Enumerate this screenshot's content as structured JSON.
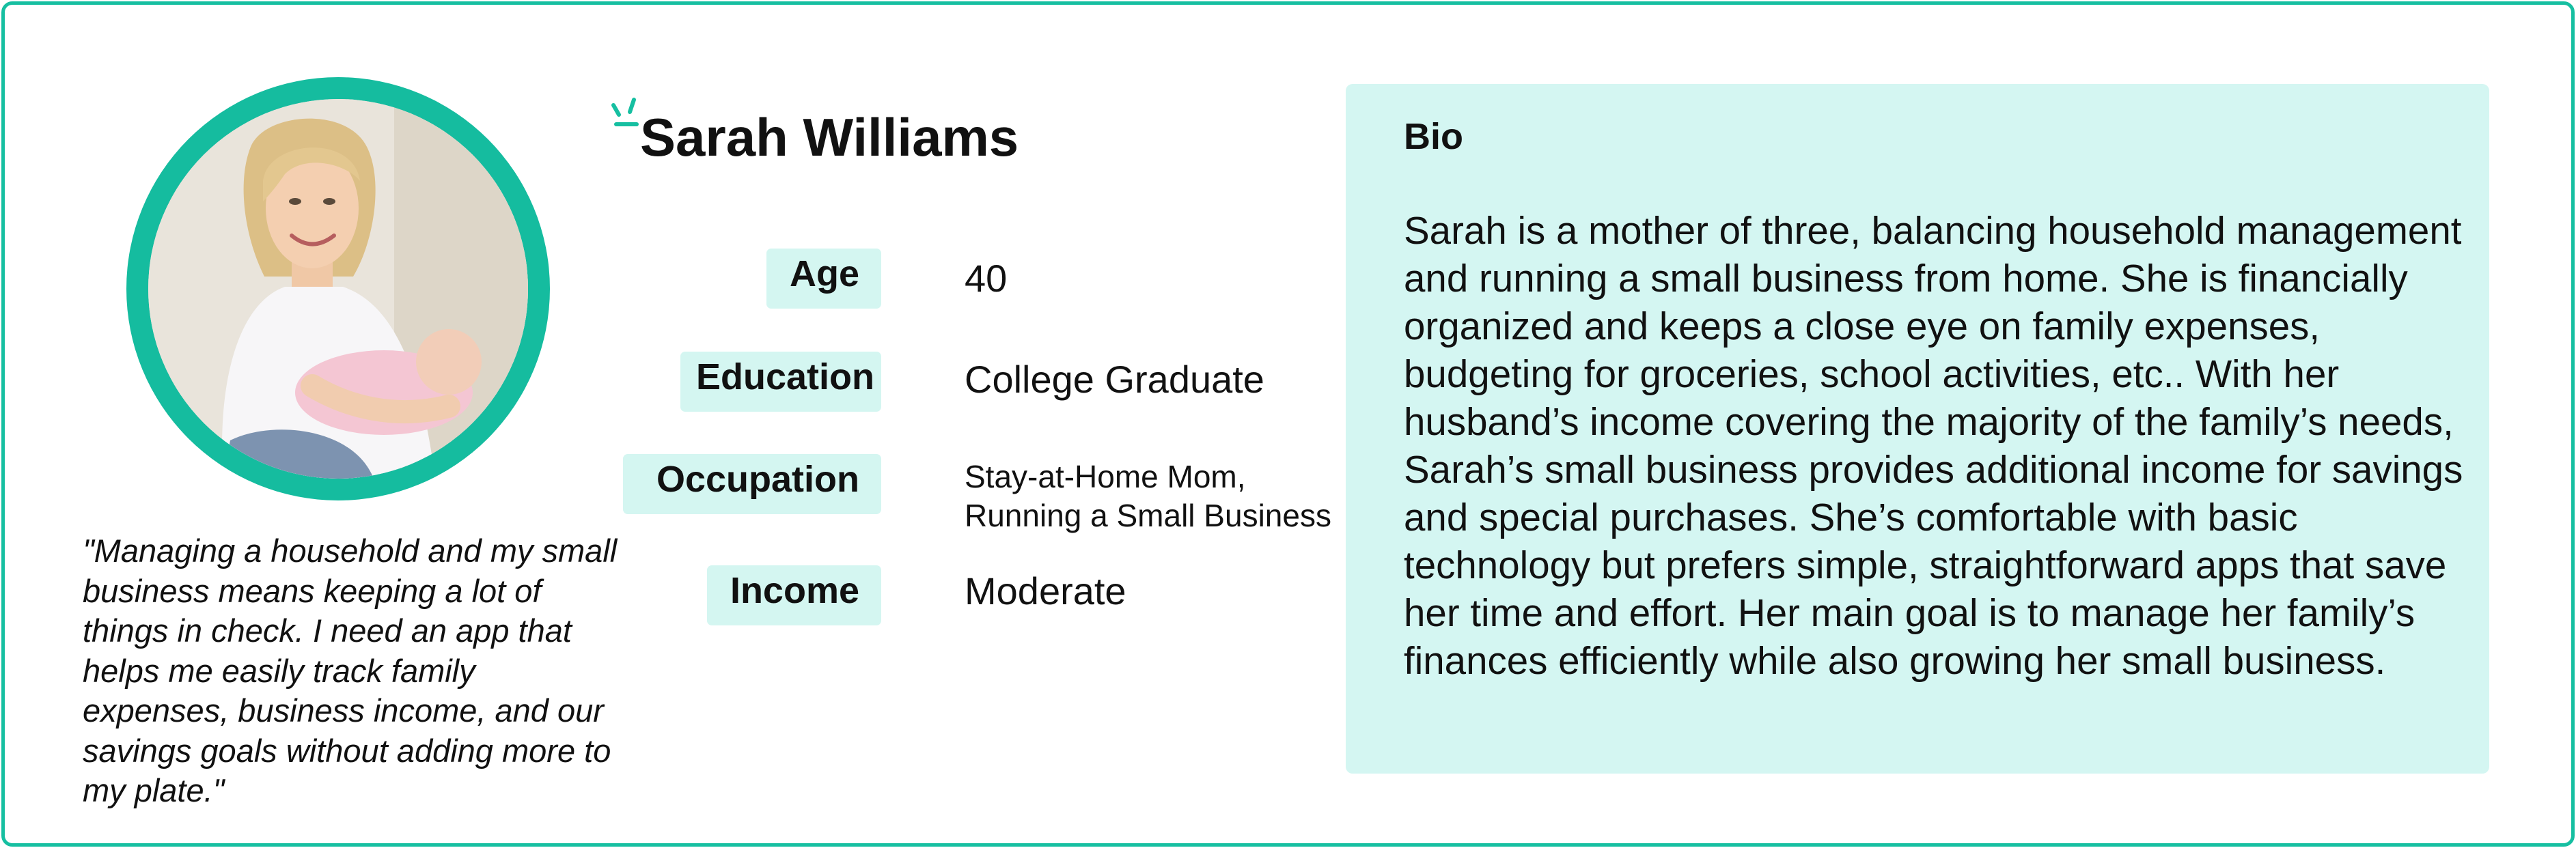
{
  "persona": {
    "name": "Sarah Williams",
    "photo": "mother-holding-baby-photo",
    "quote": "\"Managing a household and my small business means keeping a lot of things in check. I need an app that helps me easily track family expenses, business income, and our savings goals without adding more to my plate.\""
  },
  "attributes": [
    {
      "label": "Age",
      "value": "40"
    },
    {
      "label": "Education",
      "value": "College Graduate"
    },
    {
      "label": "Occupation",
      "value_line1": "Stay-at-Home Mom,",
      "value_line2": "Running a Small Business"
    },
    {
      "label": "Income",
      "value": "Moderate"
    }
  ],
  "bio": {
    "title": "Bio",
    "text": "Sarah is a mother of three, balancing household management and running a small business from home. She is financially organized and keeps a close eye on family expenses, budgeting for groceries, school activities, etc.. With her husband’s income covering the majority of the family’s needs, Sarah’s small business provides additional income for savings and special purchases. She’s comfortable with basic technology but prefers simple, straightforward apps that save her time and effort. Her main goal is to manage her family’s finances efficiently while also growing her small business."
  },
  "colors": {
    "accent": "#16bfa1",
    "label_background": "#d4f6f1",
    "bio_background": "#d4f6f2"
  }
}
